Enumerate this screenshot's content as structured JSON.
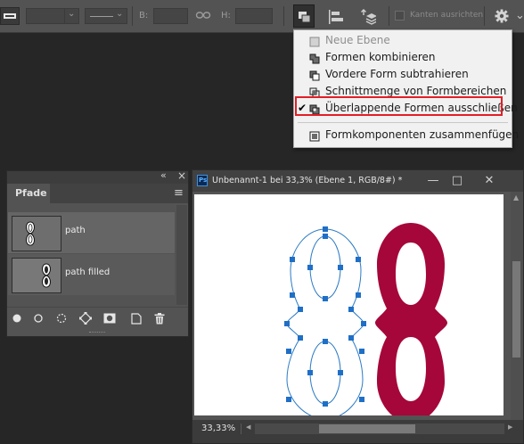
{
  "optionsbar": {
    "width_label": "B:",
    "height_label": "H:",
    "align_edges_label": "Kanten ausrichten"
  },
  "path_ops_menu": {
    "items": [
      {
        "label": "Neue Ebene",
        "enabled": false,
        "checked": false,
        "icon": "new-layer-icon"
      },
      {
        "label": "Formen kombinieren",
        "enabled": true,
        "checked": false,
        "icon": "combine-shapes-icon"
      },
      {
        "label": "Vordere Form subtrahieren",
        "enabled": true,
        "checked": false,
        "icon": "subtract-front-shape-icon"
      },
      {
        "label": "Schnittmenge von Formbereichen",
        "enabled": true,
        "checked": false,
        "icon": "intersect-shape-areas-icon"
      },
      {
        "label": "Überlappende Formen ausschließen",
        "enabled": true,
        "checked": true,
        "icon": "exclude-overlapping-shapes-icon"
      },
      {
        "label": "Formkomponenten zusammenfügen",
        "enabled": true,
        "checked": false,
        "icon": "merge-shape-components-icon"
      }
    ],
    "checkmark": "✔"
  },
  "paths_panel": {
    "tab_label": "Pfade",
    "collapse_glyph": "«",
    "close_glyph": "×",
    "menu_glyph": "≡",
    "paths": [
      {
        "name": "path",
        "selected": true
      },
      {
        "name": "path filled",
        "selected": false
      }
    ]
  },
  "document": {
    "ps_badge": "Ps",
    "title": "Unbenannt-1 bei 33,3% (Ebene 1, RGB/8#) *",
    "minimize_glyph": "—",
    "maximize_glyph": "□",
    "close_glyph": "✕",
    "zoom": "33,33%",
    "colors": {
      "path_stroke": "#2b7ac4",
      "anchor": "#1f6fc7",
      "filled_shape": "#a5073a"
    }
  }
}
